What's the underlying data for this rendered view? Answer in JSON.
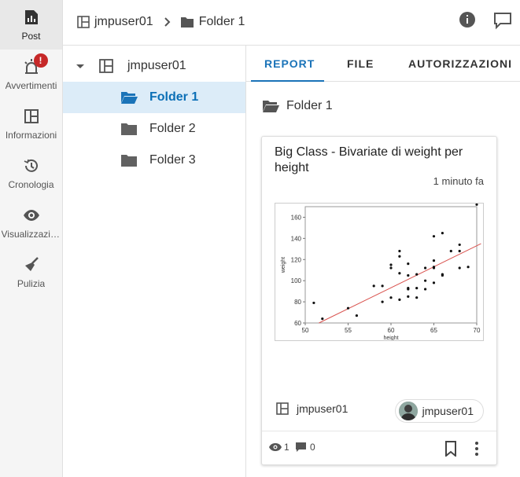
{
  "rail": {
    "items": [
      {
        "label": "Post",
        "icon": "post-chart-icon"
      },
      {
        "label": "Avvertimenti",
        "icon": "alarm-icon",
        "badge": "!"
      },
      {
        "label": "Informazioni",
        "icon": "layout-icon"
      },
      {
        "label": "Cronologia",
        "icon": "history-icon"
      },
      {
        "label": "Visualizzazioni",
        "icon": "eye-icon"
      },
      {
        "label": "Pulizia",
        "icon": "broom-icon"
      }
    ]
  },
  "breadcrumb": {
    "workspace": "jmpuser01",
    "folder": "Folder 1"
  },
  "tree": {
    "root": "jmpuser01",
    "folders": [
      "Folder 1",
      "Folder 2",
      "Folder 3"
    ],
    "selected": "Folder 1"
  },
  "tabs": [
    "REPORT",
    "FILE",
    "AUTORIZZAZIONI"
  ],
  "active_tab": "REPORT",
  "folder_heading": "Folder 1",
  "card": {
    "title": "Big Class - Bivariate di weight per height",
    "time": "1 minuto fa",
    "owner_workspace": "jmpuser01",
    "author": "jmpuser01",
    "views": "1",
    "comments": "0"
  },
  "chart_data": {
    "type": "scatter",
    "xlabel": "height",
    "ylabel": "weight",
    "xlim": [
      50,
      70
    ],
    "ylim": [
      60,
      170
    ],
    "xticks": [
      "50",
      "55",
      "60",
      "65",
      "70"
    ],
    "yticks": [
      "60",
      "80",
      "100",
      "120",
      "140",
      "160"
    ],
    "grid": false,
    "fit_line": {
      "x": [
        51.6,
        70.5
      ],
      "y": [
        60,
        135
      ],
      "color": "#d9534f"
    },
    "points": [
      [
        51,
        79
      ],
      [
        52,
        64
      ],
      [
        55,
        74
      ],
      [
        56,
        67
      ],
      [
        58,
        95
      ],
      [
        59,
        95
      ],
      [
        59,
        80
      ],
      [
        60,
        84
      ],
      [
        60,
        112
      ],
      [
        60,
        115
      ],
      [
        61,
        128
      ],
      [
        61,
        123
      ],
      [
        61,
        107
      ],
      [
        61,
        82
      ],
      [
        62,
        116
      ],
      [
        62,
        105
      ],
      [
        62,
        93
      ],
      [
        62,
        92
      ],
      [
        62,
        85
      ],
      [
        63,
        106
      ],
      [
        63,
        84
      ],
      [
        63,
        93
      ],
      [
        64,
        112
      ],
      [
        64,
        100
      ],
      [
        64,
        92
      ],
      [
        65,
        142
      ],
      [
        65,
        119
      ],
      [
        65,
        113
      ],
      [
        65,
        112
      ],
      [
        65,
        98
      ],
      [
        66,
        145
      ],
      [
        66,
        106
      ],
      [
        66,
        105
      ],
      [
        67,
        128
      ],
      [
        68,
        134
      ],
      [
        68,
        128
      ],
      [
        68,
        112
      ],
      [
        69,
        113
      ],
      [
        70,
        172
      ]
    ]
  },
  "colors": {
    "accent": "#1a73b8",
    "selected_bg": "#dcecf8",
    "badge": "#c62828",
    "folder_icon": "#616161"
  }
}
